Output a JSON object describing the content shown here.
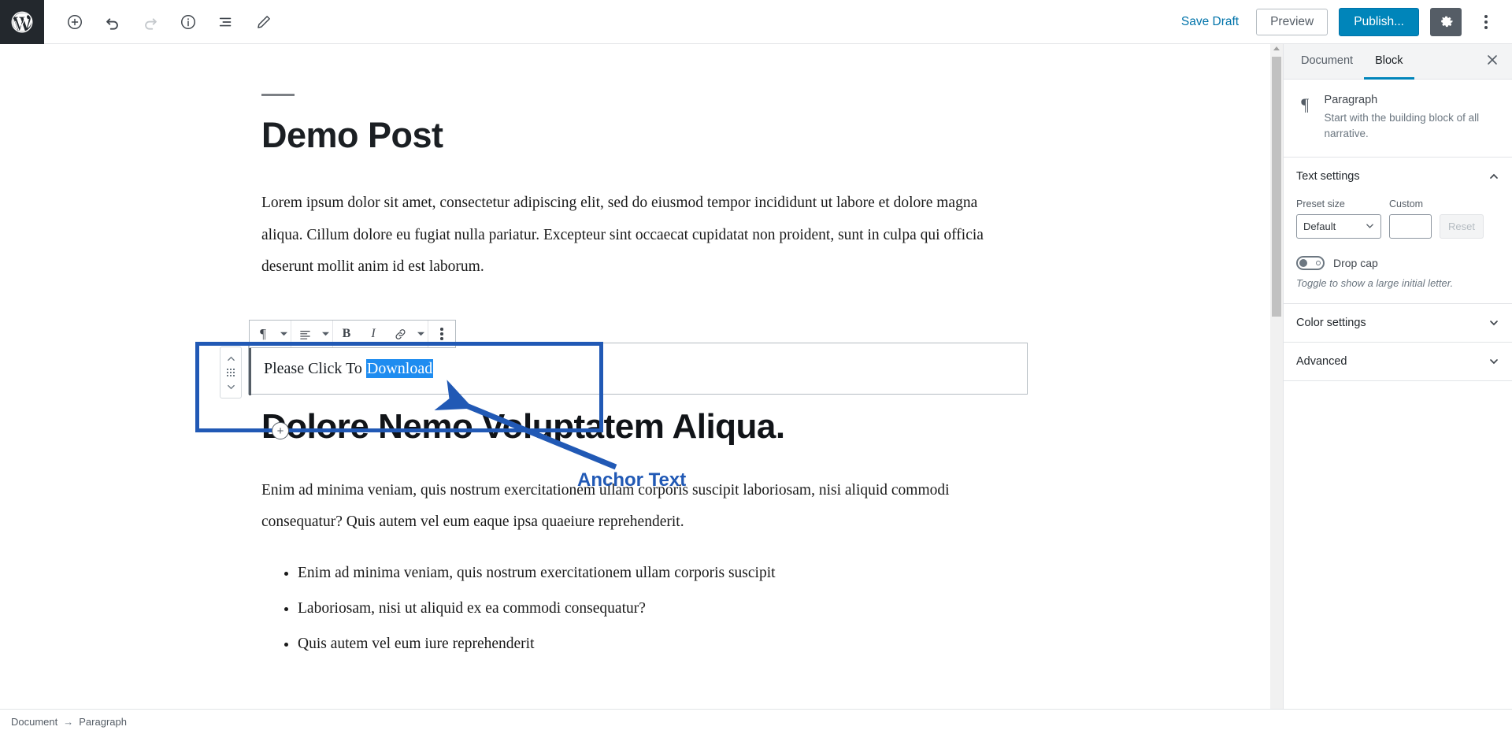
{
  "topbar": {
    "logo_icon": "wordpress-logo",
    "left_icons": [
      {
        "name": "add-block-icon",
        "label": "Add block"
      },
      {
        "name": "undo-icon",
        "label": "Undo"
      },
      {
        "name": "redo-icon",
        "label": "Redo"
      },
      {
        "name": "info-icon",
        "label": "Content structure"
      },
      {
        "name": "block-navigation-icon",
        "label": "Block navigation"
      },
      {
        "name": "pencil-edit-icon",
        "label": "Edit"
      }
    ],
    "save_draft_label": "Save Draft",
    "preview_label": "Preview",
    "publish_label": "Publish...",
    "settings_icon": "gear-icon",
    "more_icon": "kebab-menu-icon"
  },
  "content": {
    "post_title": "Demo Post",
    "paragraph_1": "Lorem ipsum dolor sit amet, consectetur adipiscing elit, sed do eiusmod tempor incididunt ut labore et dolore magna aliqua. Cillum dolore eu fugiat nulla pariatur. Excepteur sint occaecat cupidatat non proident, sunt in culpa qui officia deserunt mollit anim id est laborum.",
    "selected_block_text_plain": "Please Click To ",
    "selected_block_text_highlight": "Download",
    "section_heading": "Dolore Nemo Voluptatem Aliqua.",
    "paragraph_2": "Enim ad minima veniam, quis nostrum exercitationem ullam corporis suscipit laboriosam, nisi  aliquid  commodi consequatur? Quis autem vel eum eaque ipsa quaeiure reprehenderit.",
    "bullets": [
      "Enim ad minima veniam, quis nostrum exercitationem ullam corporis suscipit",
      "Laboriosam, nisi ut aliquid ex ea commodi consequatur?",
      "Quis autem vel eum iure reprehenderit"
    ]
  },
  "block_toolbar": {
    "paragraph_icon": "paragraph-pilcrow-icon",
    "paragraph_caret": "chevron-down-icon",
    "align_icon": "align-left-icon",
    "align_caret": "chevron-down-icon",
    "bold_label": "B",
    "italic_label": "I",
    "link_icon": "link-icon",
    "more_formats_caret": "chevron-down-icon",
    "options_icon": "kebab-menu-icon"
  },
  "block_mover": {
    "up_icon": "chevron-up-icon",
    "drag_icon": "drag-handle-icon",
    "down_icon": "chevron-down-icon",
    "inserter_icon": "plus-circle-icon"
  },
  "annotation": {
    "label": "Anchor Text",
    "color": "#2159b5",
    "arrow_icon": "arrow-pointer-icon",
    "highlight_box_icon": "highlight-rectangle"
  },
  "sidebar": {
    "tabs": [
      {
        "label": "Document",
        "active": false
      },
      {
        "label": "Block",
        "active": true
      }
    ],
    "close_icon": "close-icon",
    "block_card": {
      "icon": "paragraph-pilcrow-icon",
      "name": "Paragraph",
      "description": "Start with the building block of all narrative."
    },
    "text_settings": {
      "title": "Text settings",
      "collapse_icon": "chevron-up-icon",
      "preset_size_label": "Preset size",
      "preset_size_value": "Default",
      "preset_caret_icon": "chevron-down-icon",
      "custom_label": "Custom",
      "custom_value": "",
      "reset_label": "Reset",
      "drop_cap_label": "Drop cap",
      "drop_cap_enabled": false,
      "drop_cap_help": "Toggle to show a large initial letter."
    },
    "color_settings": {
      "title": "Color settings",
      "expand_icon": "chevron-down-icon"
    },
    "advanced": {
      "title": "Advanced",
      "expand_icon": "chevron-down-icon"
    }
  },
  "bottombar": {
    "crumb_document": "Document",
    "crumb_arrow": "→",
    "crumb_block": "Paragraph"
  },
  "colors": {
    "accent_blue": "#0085ba",
    "link_blue": "#0073aa",
    "annotation_blue": "#2159b5",
    "selection_blue": "#1e8cf0",
    "dark_bar": "#23282d"
  }
}
